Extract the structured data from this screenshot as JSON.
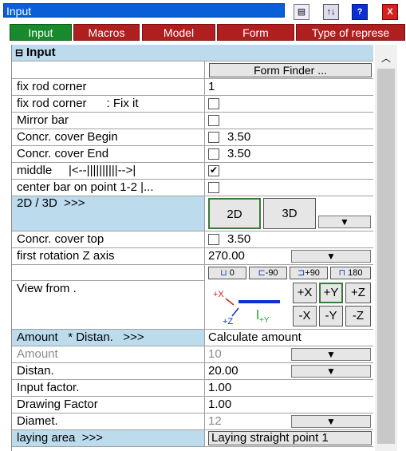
{
  "window": {
    "title": "Input"
  },
  "tabs": [
    "Input",
    "Macros",
    "Model",
    "Form",
    "Type of represe"
  ],
  "section": {
    "toggle": "⊟",
    "title": "Input"
  },
  "form_finder": "Form Finder ...",
  "rows": [
    {
      "label": "fix rod corner",
      "value": "1"
    },
    {
      "label": "fix rod corner      : Fix it",
      "value": ""
    },
    {
      "label": "Mirror bar",
      "value": ""
    },
    {
      "label": "Concr. cover Begin",
      "value": "3.50"
    },
    {
      "label": "Concr. cover End",
      "value": "3.50"
    },
    {
      "label": "middle     |<--||||||||||-->|",
      "value": ""
    },
    {
      "label": "center bar on point 1-2 |...",
      "value": ""
    }
  ],
  "dim": {
    "label": "2D / 3D  >>>",
    "btn2d": "2D",
    "btn3d": "3D"
  },
  "cover_top": {
    "label": "Concr. cover top",
    "value": "3.50"
  },
  "rotation": {
    "label": "first rotation Z axis",
    "value": "270.00",
    "opts": [
      "0",
      "-90",
      "+90",
      "180"
    ]
  },
  "view": {
    "label": "View from  .",
    "buttons": [
      "+X",
      "+Y",
      "+Z",
      "-X",
      "-Y",
      "-Z"
    ]
  },
  "amount": {
    "label": "Amount   * Distan.   >>>",
    "value": "Calculate amount"
  },
  "rows2": [
    {
      "label": "Amount",
      "value": "10",
      "gray": true
    },
    {
      "label": "Distan.",
      "value": "20.00"
    },
    {
      "label": "Input factor.",
      "value": "1.00"
    },
    {
      "label": "Drawing Factor",
      "value": "1.00"
    },
    {
      "label": "Diamet.",
      "value": "12",
      "gray": true
    }
  ],
  "laying": {
    "label": "laying area  >>>",
    "value": "Laying straight point 1"
  },
  "dropdown_glyph": "▼"
}
